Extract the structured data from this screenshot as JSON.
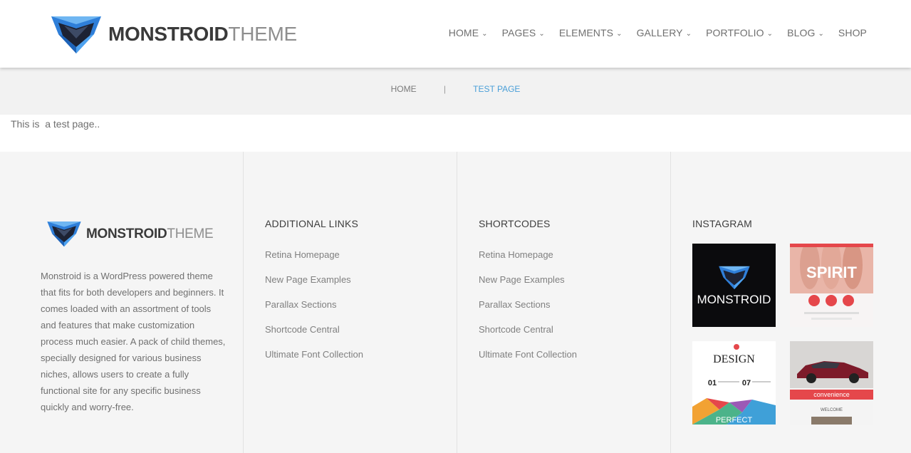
{
  "header": {
    "logo": {
      "bold": "MONSTROID",
      "light": "THEME"
    },
    "nav": [
      {
        "label": "HOME",
        "dropdown": true
      },
      {
        "label": "PAGES",
        "dropdown": true
      },
      {
        "label": "ELEMENTS",
        "dropdown": true
      },
      {
        "label": "GALLERY",
        "dropdown": true
      },
      {
        "label": "PORTFOLIO",
        "dropdown": true
      },
      {
        "label": "BLOG",
        "dropdown": true
      },
      {
        "label": "SHOP",
        "dropdown": false
      }
    ]
  },
  "breadcrumb": {
    "home": "HOME",
    "separator": "|",
    "current": "TEST PAGE"
  },
  "content": {
    "text": "This is  a test page.."
  },
  "footer": {
    "logo": {
      "bold": "MONSTROID",
      "light": "THEME"
    },
    "description": "Monstroid is a WordPress powered theme that fits for both developers and beginners. It comes loaded with an assortment of tools and features that make customization process much easier. A pack of child themes, specially designed for various business niches, allows users to create a fully functional site for any specific business quickly and worry-free.",
    "additional_links": {
      "heading": "ADDITIONAL LINKS",
      "links": [
        "Retina Homepage",
        "New Page Examples",
        "Parallax Sections",
        "Shortcode Central",
        "Ultimate Font Collection"
      ]
    },
    "shortcodes": {
      "heading": "SHORTCODES",
      "links": [
        "Retina Homepage",
        "New Page Examples",
        "Parallax Sections",
        "Shortcode Central",
        "Ultimate Font Collection"
      ]
    },
    "instagram": {
      "heading": "INSTAGRAM",
      "tiles": [
        {
          "text": "MONSTROID"
        },
        {
          "text": "SPIRIT"
        },
        {
          "text": "DESIGN",
          "numbers": [
            "01",
            "07"
          ],
          "caption": "PERFECT"
        },
        {
          "text": "convenience",
          "caption": "WELCOME"
        }
      ]
    }
  },
  "colors": {
    "accent": "#4a9fd8",
    "logo_blue": "#3b8be0",
    "text": "#6f6f6f",
    "heading": "#3d3d3d",
    "footer_bg": "#f5f5f5",
    "tile_red": "#e5474b"
  }
}
